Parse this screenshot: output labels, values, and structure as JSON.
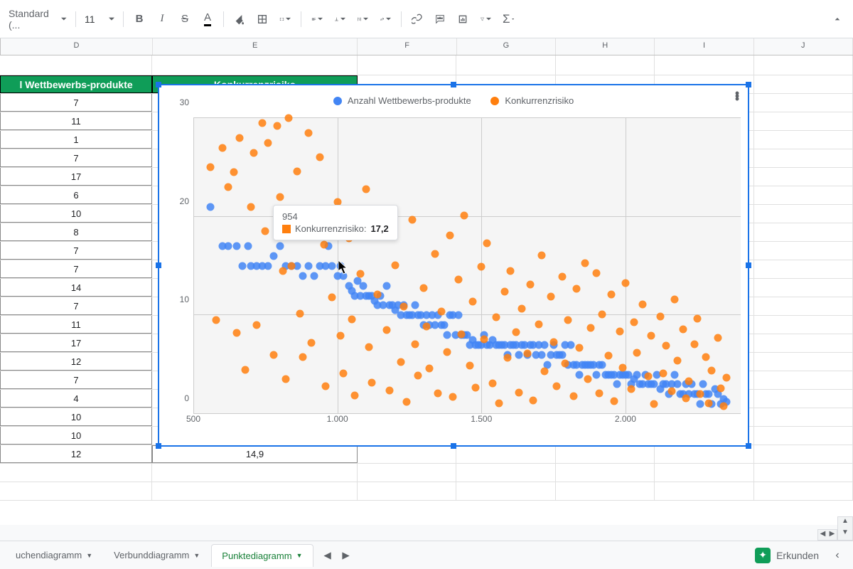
{
  "toolbar": {
    "font": "Standard (...",
    "font_size": "11"
  },
  "columns": [
    "D",
    "E",
    "F",
    "G",
    "H",
    "I",
    "J"
  ],
  "headers": {
    "d": "l Wettbewerbs-produkte",
    "e": "Konkurrenzrisiko"
  },
  "data_d": [
    "7",
    "11",
    "1",
    "7",
    "17",
    "6",
    "10",
    "8",
    "7",
    "7",
    "14",
    "7",
    "11",
    "17",
    "12",
    "7",
    "4",
    "10",
    "10",
    "12"
  ],
  "data_e_last": "14,9",
  "chart": {
    "legend": {
      "a": "Anzahl Wettbewerbs-produkte",
      "b": "Konkurrenzrisiko"
    },
    "tooltip": {
      "title": "954",
      "series": "Konkurrenzrisiko:",
      "value": "17,2"
    }
  },
  "tabs": {
    "a": "uchendiagramm",
    "b": "Verbunddiagramm",
    "c": "Punktediagramm"
  },
  "explore": "Erkunden",
  "chart_data": {
    "type": "scatter",
    "title": "",
    "xlabel": "",
    "ylabel": "",
    "xlim": [
      500,
      2400
    ],
    "ylim": [
      0,
      30
    ],
    "x_ticks": [
      500,
      1000,
      1500,
      2000
    ],
    "x_tick_labels": [
      "500",
      "1.000",
      "1.500",
      "2.000"
    ],
    "y_ticks": [
      0,
      10,
      20,
      30
    ],
    "series": [
      {
        "name": "Anzahl Wettbewerbs-produkte",
        "color": "#4285f4",
        "points": [
          [
            560,
            21
          ],
          [
            600,
            17
          ],
          [
            620,
            17
          ],
          [
            650,
            17
          ],
          [
            670,
            15
          ],
          [
            690,
            17
          ],
          [
            700,
            15
          ],
          [
            720,
            15
          ],
          [
            740,
            15
          ],
          [
            760,
            15
          ],
          [
            780,
            16
          ],
          [
            800,
            17
          ],
          [
            820,
            15
          ],
          [
            840,
            15
          ],
          [
            860,
            15
          ],
          [
            880,
            14
          ],
          [
            900,
            15
          ],
          [
            920,
            14
          ],
          [
            940,
            15
          ],
          [
            960,
            15
          ],
          [
            970,
            17
          ],
          [
            980,
            15
          ],
          [
            1000,
            14
          ],
          [
            1010,
            15
          ],
          [
            1020,
            14
          ],
          [
            1040,
            13
          ],
          [
            1050,
            12.5
          ],
          [
            1060,
            12
          ],
          [
            1070,
            13.5
          ],
          [
            1080,
            12
          ],
          [
            1090,
            13
          ],
          [
            1100,
            12
          ],
          [
            1110,
            12
          ],
          [
            1120,
            12
          ],
          [
            1130,
            11.5
          ],
          [
            1140,
            11
          ],
          [
            1150,
            12
          ],
          [
            1160,
            11
          ],
          [
            1170,
            13
          ],
          [
            1180,
            11
          ],
          [
            1190,
            11
          ],
          [
            1200,
            10.5
          ],
          [
            1210,
            11
          ],
          [
            1220,
            10
          ],
          [
            1230,
            11
          ],
          [
            1240,
            10
          ],
          [
            1250,
            10
          ],
          [
            1260,
            10
          ],
          [
            1270,
            11
          ],
          [
            1280,
            10
          ],
          [
            1290,
            10
          ],
          [
            1300,
            9
          ],
          [
            1310,
            10
          ],
          [
            1320,
            9
          ],
          [
            1330,
            10
          ],
          [
            1340,
            9
          ],
          [
            1350,
            10
          ],
          [
            1360,
            9
          ],
          [
            1370,
            9
          ],
          [
            1380,
            8
          ],
          [
            1390,
            10
          ],
          [
            1400,
            10
          ],
          [
            1410,
            8
          ],
          [
            1420,
            10
          ],
          [
            1430,
            8
          ],
          [
            1440,
            8
          ],
          [
            1450,
            8
          ],
          [
            1460,
            7
          ],
          [
            1470,
            7.5
          ],
          [
            1480,
            7
          ],
          [
            1490,
            7
          ],
          [
            1500,
            7
          ],
          [
            1510,
            8
          ],
          [
            1520,
            7
          ],
          [
            1530,
            7
          ],
          [
            1540,
            7.5
          ],
          [
            1550,
            7
          ],
          [
            1560,
            7
          ],
          [
            1570,
            7
          ],
          [
            1580,
            7
          ],
          [
            1590,
            6
          ],
          [
            1600,
            7
          ],
          [
            1610,
            7
          ],
          [
            1620,
            7
          ],
          [
            1630,
            6
          ],
          [
            1640,
            7
          ],
          [
            1650,
            7
          ],
          [
            1660,
            6
          ],
          [
            1670,
            7
          ],
          [
            1680,
            7
          ],
          [
            1690,
            6
          ],
          [
            1700,
            7
          ],
          [
            1710,
            6
          ],
          [
            1720,
            7
          ],
          [
            1730,
            5
          ],
          [
            1740,
            6
          ],
          [
            1750,
            7
          ],
          [
            1760,
            6
          ],
          [
            1770,
            6
          ],
          [
            1780,
            6
          ],
          [
            1790,
            7
          ],
          [
            1800,
            5
          ],
          [
            1810,
            7
          ],
          [
            1820,
            5
          ],
          [
            1830,
            5
          ],
          [
            1840,
            4
          ],
          [
            1850,
            5
          ],
          [
            1860,
            5
          ],
          [
            1870,
            5
          ],
          [
            1880,
            5
          ],
          [
            1890,
            5
          ],
          [
            1900,
            4
          ],
          [
            1910,
            5
          ],
          [
            1920,
            5
          ],
          [
            1930,
            4
          ],
          [
            1940,
            4
          ],
          [
            1950,
            4
          ],
          [
            1960,
            4
          ],
          [
            1970,
            3
          ],
          [
            1980,
            4
          ],
          [
            1990,
            4
          ],
          [
            2000,
            4
          ],
          [
            2010,
            4
          ],
          [
            2020,
            3
          ],
          [
            2030,
            3.5
          ],
          [
            2040,
            4
          ],
          [
            2050,
            3
          ],
          [
            2060,
            3
          ],
          [
            2070,
            4
          ],
          [
            2080,
            3
          ],
          [
            2090,
            3
          ],
          [
            2100,
            3
          ],
          [
            2110,
            4
          ],
          [
            2120,
            2.5
          ],
          [
            2130,
            3
          ],
          [
            2140,
            3
          ],
          [
            2150,
            2
          ],
          [
            2160,
            3
          ],
          [
            2170,
            4
          ],
          [
            2180,
            3
          ],
          [
            2190,
            2
          ],
          [
            2200,
            2
          ],
          [
            2210,
            3
          ],
          [
            2220,
            2
          ],
          [
            2230,
            3
          ],
          [
            2240,
            2
          ],
          [
            2250,
            2
          ],
          [
            2260,
            1
          ],
          [
            2270,
            3
          ],
          [
            2280,
            2
          ],
          [
            2290,
            2
          ],
          [
            2300,
            1
          ],
          [
            2310,
            2.5
          ],
          [
            2320,
            2
          ],
          [
            2330,
            1
          ],
          [
            2340,
            1.5
          ],
          [
            2350,
            1.2
          ]
        ]
      },
      {
        "name": "Konkurrenzrisiko",
        "color": "#ff7f0e",
        "points": [
          [
            560,
            25
          ],
          [
            580,
            9.5
          ],
          [
            600,
            27
          ],
          [
            620,
            23
          ],
          [
            640,
            24.5
          ],
          [
            650,
            8.2
          ],
          [
            660,
            28
          ],
          [
            680,
            4.5
          ],
          [
            700,
            21
          ],
          [
            710,
            26.5
          ],
          [
            720,
            9
          ],
          [
            740,
            29.5
          ],
          [
            750,
            18.5
          ],
          [
            760,
            27.5
          ],
          [
            780,
            6
          ],
          [
            790,
            29.2
          ],
          [
            800,
            22
          ],
          [
            810,
            14.5
          ],
          [
            820,
            3.5
          ],
          [
            830,
            30
          ],
          [
            840,
            15
          ],
          [
            860,
            24.6
          ],
          [
            870,
            10.2
          ],
          [
            880,
            5.8
          ],
          [
            900,
            28.5
          ],
          [
            910,
            7.2
          ],
          [
            920,
            19.5
          ],
          [
            940,
            26
          ],
          [
            954,
            17.2
          ],
          [
            960,
            2.8
          ],
          [
            980,
            11.8
          ],
          [
            1000,
            21.5
          ],
          [
            1010,
            7.9
          ],
          [
            1020,
            4.1
          ],
          [
            1040,
            17.8
          ],
          [
            1050,
            9.6
          ],
          [
            1060,
            1.9
          ],
          [
            1080,
            14.2
          ],
          [
            1100,
            22.8
          ],
          [
            1110,
            6.8
          ],
          [
            1120,
            3.2
          ],
          [
            1140,
            12.1
          ],
          [
            1160,
            18.3
          ],
          [
            1170,
            8.5
          ],
          [
            1180,
            2.4
          ],
          [
            1200,
            15.1
          ],
          [
            1220,
            5.3
          ],
          [
            1230,
            10.9
          ],
          [
            1240,
            1.2
          ],
          [
            1260,
            19.7
          ],
          [
            1270,
            7.1
          ],
          [
            1280,
            3.9
          ],
          [
            1300,
            12.8
          ],
          [
            1310,
            8.9
          ],
          [
            1320,
            4.6
          ],
          [
            1340,
            16.2
          ],
          [
            1350,
            2.1
          ],
          [
            1360,
            10.4
          ],
          [
            1380,
            6.3
          ],
          [
            1390,
            18.1
          ],
          [
            1400,
            1.7
          ],
          [
            1420,
            13.6
          ],
          [
            1430,
            8.1
          ],
          [
            1440,
            20.1
          ],
          [
            1460,
            4.9
          ],
          [
            1470,
            11.4
          ],
          [
            1480,
            2.7
          ],
          [
            1500,
            14.9
          ],
          [
            1510,
            7.6
          ],
          [
            1520,
            17.3
          ],
          [
            1540,
            3.1
          ],
          [
            1550,
            9.8
          ],
          [
            1560,
            1.1
          ],
          [
            1580,
            12.4
          ],
          [
            1590,
            5.7
          ],
          [
            1600,
            14.5
          ],
          [
            1620,
            8.3
          ],
          [
            1630,
            2.2
          ],
          [
            1640,
            10.7
          ],
          [
            1660,
            6.1
          ],
          [
            1670,
            13.1
          ],
          [
            1680,
            1.4
          ],
          [
            1700,
            9.1
          ],
          [
            1710,
            16.1
          ],
          [
            1720,
            4.3
          ],
          [
            1740,
            11.9
          ],
          [
            1750,
            7.3
          ],
          [
            1760,
            2.8
          ],
          [
            1780,
            13.9
          ],
          [
            1790,
            5.1
          ],
          [
            1800,
            9.5
          ],
          [
            1820,
            1.8
          ],
          [
            1830,
            12.7
          ],
          [
            1840,
            6.7
          ],
          [
            1860,
            15.3
          ],
          [
            1870,
            3.5
          ],
          [
            1880,
            8.7
          ],
          [
            1900,
            14.3
          ],
          [
            1910,
            2.1
          ],
          [
            1920,
            10.1
          ],
          [
            1940,
            5.9
          ],
          [
            1950,
            12.1
          ],
          [
            1960,
            1.3
          ],
          [
            1980,
            8.4
          ],
          [
            1990,
            4.7
          ],
          [
            2000,
            13.3
          ],
          [
            2020,
            2.5
          ],
          [
            2030,
            9.3
          ],
          [
            2040,
            6.2
          ],
          [
            2060,
            11.1
          ],
          [
            2080,
            3.8
          ],
          [
            2090,
            7.9
          ],
          [
            2100,
            1.0
          ],
          [
            2120,
            9.9
          ],
          [
            2130,
            4.1
          ],
          [
            2140,
            6.9
          ],
          [
            2160,
            2.3
          ],
          [
            2170,
            11.6
          ],
          [
            2180,
            5.4
          ],
          [
            2200,
            8.6
          ],
          [
            2210,
            1.6
          ],
          [
            2220,
            3.3
          ],
          [
            2240,
            7.1
          ],
          [
            2250,
            9.7
          ],
          [
            2260,
            2.0
          ],
          [
            2280,
            5.8
          ],
          [
            2290,
            1.1
          ],
          [
            2300,
            4.4
          ],
          [
            2320,
            7.7
          ],
          [
            2330,
            2.6
          ],
          [
            2340,
            0.8
          ],
          [
            2350,
            3.7
          ]
        ]
      }
    ]
  }
}
